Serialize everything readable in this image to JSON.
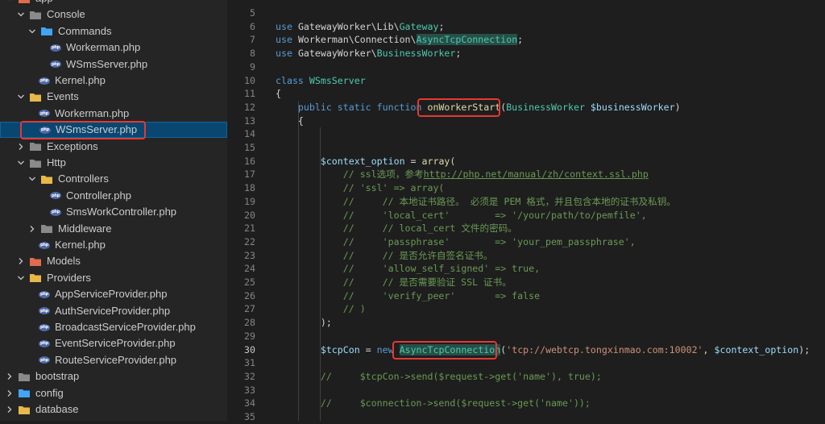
{
  "explorer": {
    "items": [
      {
        "label": "app",
        "type": "folder-open",
        "depth": 0,
        "icon": "app-folder-icon"
      },
      {
        "label": "Console",
        "type": "folder-open",
        "depth": 1
      },
      {
        "label": "Commands",
        "type": "folder-open",
        "depth": 2,
        "icon": "commands-folder-icon"
      },
      {
        "label": "Workerman.php",
        "type": "php",
        "depth": 3
      },
      {
        "label": "WSmsServer.php",
        "type": "php",
        "depth": 3
      },
      {
        "label": "Kernel.php",
        "type": "php",
        "depth": 2
      },
      {
        "label": "Events",
        "type": "folder-open",
        "depth": 1,
        "icon": "events-folder-icon"
      },
      {
        "label": "Workerman.php",
        "type": "php",
        "depth": 2
      },
      {
        "label": "WSmsServer.php",
        "type": "php",
        "depth": 2,
        "selected": true
      },
      {
        "label": "Exceptions",
        "type": "folder-closed",
        "depth": 1
      },
      {
        "label": "Http",
        "type": "folder-open",
        "depth": 1
      },
      {
        "label": "Controllers",
        "type": "folder-open",
        "depth": 2,
        "icon": "controllers-folder-icon"
      },
      {
        "label": "Controller.php",
        "type": "php",
        "depth": 3
      },
      {
        "label": "SmsWorkController.php",
        "type": "php",
        "depth": 3
      },
      {
        "label": "Middleware",
        "type": "folder-closed",
        "depth": 2
      },
      {
        "label": "Kernel.php",
        "type": "php",
        "depth": 2
      },
      {
        "label": "Models",
        "type": "folder-closed",
        "depth": 1,
        "icon": "models-folder-icon"
      },
      {
        "label": "Providers",
        "type": "folder-open",
        "depth": 1,
        "icon": "providers-folder-icon"
      },
      {
        "label": "AppServiceProvider.php",
        "type": "php",
        "depth": 2
      },
      {
        "label": "AuthServiceProvider.php",
        "type": "php",
        "depth": 2
      },
      {
        "label": "BroadcastServiceProvider.php",
        "type": "php",
        "depth": 2
      },
      {
        "label": "EventServiceProvider.php",
        "type": "php",
        "depth": 2
      },
      {
        "label": "RouteServiceProvider.php",
        "type": "php",
        "depth": 2
      },
      {
        "label": "bootstrap",
        "type": "folder-closed",
        "depth": 0
      },
      {
        "label": "config",
        "type": "folder-closed",
        "depth": 0,
        "icon": "config-folder-icon"
      },
      {
        "label": "database",
        "type": "folder-closed",
        "depth": 0,
        "icon": "database-folder-icon"
      }
    ],
    "php_badge": "php"
  },
  "editor": {
    "lines": [
      {
        "n": "5",
        "tokens": []
      },
      {
        "n": "6",
        "tokens": [
          [
            "kw",
            "use"
          ],
          [
            "",
            "GatewayWorker\\Lib\\"
          ],
          [
            "cls",
            "Gateway"
          ],
          [
            "",
            ";"
          ]
        ]
      },
      {
        "n": "7",
        "tokens": [
          [
            "kw",
            "use"
          ],
          [
            "",
            "Workerman\\Connection\\"
          ],
          [
            "cls hl",
            "AsyncTcpConnection"
          ],
          [
            "",
            ";"
          ]
        ]
      },
      {
        "n": "8",
        "tokens": [
          [
            "kw",
            "use"
          ],
          [
            "",
            "GatewayWorker\\"
          ],
          [
            "cls",
            "BusinessWorker"
          ],
          [
            "",
            ";"
          ]
        ]
      },
      {
        "n": "9",
        "tokens": []
      },
      {
        "n": "10",
        "tokens": [
          [
            "kw",
            "class"
          ],
          [
            "",
            ""
          ],
          [
            "cls",
            "WSmsServer"
          ]
        ]
      },
      {
        "n": "11",
        "tokens": [
          [
            "",
            "{"
          ]
        ]
      },
      {
        "n": "12",
        "tokens": [
          [
            "",
            "    "
          ],
          [
            "kw",
            "public static function"
          ],
          [
            "",
            ""
          ],
          [
            "fn",
            "onWorkerStart"
          ],
          [
            "",
            "("
          ],
          [
            "cls",
            "BusinessWorker"
          ],
          [
            "",
            ""
          ],
          [
            "var",
            "$businessWorker"
          ],
          [
            "",
            ")"
          ]
        ]
      },
      {
        "n": "13",
        "tokens": [
          [
            "",
            "    {"
          ]
        ]
      },
      {
        "n": "14",
        "tokens": []
      },
      {
        "n": "15",
        "tokens": []
      },
      {
        "n": "16",
        "tokens": [
          [
            "",
            "        "
          ],
          [
            "var",
            "$context_option"
          ],
          [
            "",
            " = "
          ],
          [
            "fn",
            "array"
          ],
          [
            "",
            "("
          ]
        ]
      },
      {
        "n": "17",
        "tokens": [
          [
            "cmt",
            "            // ssl选项，参考"
          ],
          [
            "url",
            "http://php.net/manual/zh/context.ssl.php"
          ]
        ]
      },
      {
        "n": "18",
        "tokens": [
          [
            "cmt",
            "            // 'ssl' => array("
          ]
        ]
      },
      {
        "n": "19",
        "tokens": [
          [
            "cmt",
            "            //     // 本地证书路径。 必须是 PEM 格式，并且包含本地的证书及私钥。"
          ]
        ]
      },
      {
        "n": "20",
        "tokens": [
          [
            "cmt",
            "            //     'local_cert'        => '/your/path/to/pemfile',"
          ]
        ]
      },
      {
        "n": "21",
        "tokens": [
          [
            "cmt",
            "            //     // local_cert 文件的密码。"
          ]
        ]
      },
      {
        "n": "22",
        "tokens": [
          [
            "cmt",
            "            //     'passphrase'        => 'your_pem_passphrase',"
          ]
        ]
      },
      {
        "n": "23",
        "tokens": [
          [
            "cmt",
            "            //     // 是否允许自签名证书。"
          ]
        ]
      },
      {
        "n": "24",
        "tokens": [
          [
            "cmt",
            "            //     'allow_self_signed' => true,"
          ]
        ]
      },
      {
        "n": "25",
        "tokens": [
          [
            "cmt",
            "            //     // 是否需要验证 SSL 证书。"
          ]
        ]
      },
      {
        "n": "26",
        "tokens": [
          [
            "cmt",
            "            //     'verify_peer'       => false"
          ]
        ]
      },
      {
        "n": "27",
        "tokens": [
          [
            "cmt",
            "            // )"
          ]
        ]
      },
      {
        "n": "28",
        "tokens": [
          [
            "",
            "        );"
          ]
        ]
      },
      {
        "n": "29",
        "tokens": []
      },
      {
        "n": "30",
        "tokens": [
          [
            "",
            "        "
          ],
          [
            "var",
            "$tcpCon"
          ],
          [
            "",
            " = "
          ],
          [
            "kw",
            "new"
          ],
          [
            "",
            ""
          ],
          [
            "cls hl",
            "AsyncTcpConnection"
          ],
          [
            "",
            "("
          ],
          [
            "str",
            "'tcp://webtcp.tongxinmao.com:10002'"
          ],
          [
            "",
            ", "
          ],
          [
            "var",
            "$context_option"
          ],
          [
            "",
            ");"
          ]
        ]
      },
      {
        "n": "31",
        "tokens": []
      },
      {
        "n": "32",
        "tokens": [
          [
            "cmt",
            "        //     $tcpCon->send($request->get('name'), true);"
          ]
        ]
      },
      {
        "n": "33",
        "tokens": []
      },
      {
        "n": "34",
        "tokens": [
          [
            "cmt",
            "        //     $connection->send($request->get('name'));"
          ]
        ]
      },
      {
        "n": "35",
        "tokens": []
      }
    ],
    "active_line": "30"
  },
  "colors": {
    "sidebar_bg": "#252526",
    "editor_bg": "#1e1e1e",
    "selection": "#094771",
    "annotation_red": "#e53935"
  }
}
